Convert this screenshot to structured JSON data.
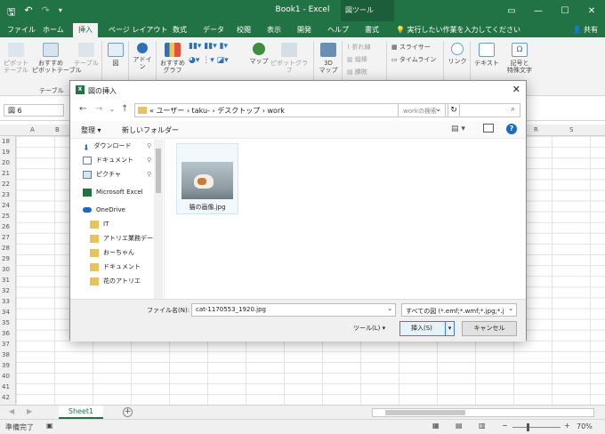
{
  "window": {
    "title": "Book1 - Excel",
    "context_tool": "図ツール"
  },
  "tabs": [
    {
      "label": "ファイル",
      "active": false
    },
    {
      "label": "ホーム",
      "active": false
    },
    {
      "label": "挿入",
      "active": true
    },
    {
      "label": "ページ レイアウト",
      "active": false
    },
    {
      "label": "数式",
      "active": false
    },
    {
      "label": "データ",
      "active": false
    },
    {
      "label": "校閲",
      "active": false
    },
    {
      "label": "表示",
      "active": false
    },
    {
      "label": "開発",
      "active": false
    },
    {
      "label": "ヘルプ",
      "active": false
    },
    {
      "label": "書式",
      "active": false
    }
  ],
  "tellme": "実行したい作業を入力してください",
  "share": "共有",
  "ribbon": {
    "pivot": "ピボット\nテーブル",
    "recommended_pivot": "おすすめ\nピボットテーブル",
    "table": "テーブル",
    "figure": "図",
    "addins": "アドイン",
    "recommended_chart": "おすすめ\nグラフ",
    "map": "マップ",
    "pivot_chart": "ピボットグラフ",
    "map3d": "3D\nマップ",
    "line": "折れ線",
    "column": "縦棒",
    "winloss": "勝敗",
    "slicer": "スライサー",
    "timeline": "タイムライン",
    "link": "リンク",
    "text": "テキスト",
    "symbol": "記号と\n特殊文字",
    "group_table": "テーブル"
  },
  "namebox": "図 6",
  "columns": [
    "A",
    "B",
    "R",
    "S"
  ],
  "rows": [
    "18",
    "19",
    "20",
    "21",
    "22",
    "23",
    "24",
    "25",
    "26",
    "27",
    "28",
    "29",
    "30",
    "31",
    "32",
    "33",
    "34",
    "35",
    "36",
    "37",
    "38",
    "39",
    "40",
    "41",
    "42"
  ],
  "sheet_tab": "Sheet1",
  "status": {
    "ready": "準備完了",
    "zoom": "70%"
  },
  "dialog": {
    "title": "図の挿入",
    "path": "« ユーザー › taku- › デスクトップ › work",
    "search_placeholder": "workの検索",
    "organize": "整理 ▾",
    "new_folder": "新しいフォルダー",
    "nav_items": [
      {
        "label": "ダウンロード",
        "icon": "download-icon",
        "pinned": true
      },
      {
        "label": "ドキュメント",
        "icon": "document-icon",
        "pinned": true
      },
      {
        "label": "ピクチャ",
        "icon": "picture-icon",
        "pinned": true
      },
      {
        "label": "Microsoft Excel",
        "icon": "excel-icon",
        "pinned": false
      },
      {
        "label": "OneDrive",
        "icon": "onedrive-icon",
        "pinned": false
      },
      {
        "label": "IT",
        "icon": "folder-icon",
        "pinned": false
      },
      {
        "label": "アトリエ業務データ",
        "icon": "folder-icon",
        "pinned": false
      },
      {
        "label": "おーちゃん",
        "icon": "folder-icon",
        "pinned": false
      },
      {
        "label": "ドキュメント",
        "icon": "folder-icon",
        "pinned": false
      },
      {
        "label": "花のアトリエ",
        "icon": "folder-icon",
        "pinned": false
      }
    ],
    "file_label": "猫の画像.jpg",
    "filename_label": "ファイル名(N):",
    "filename_value": "cat-1170553_1920.jpg",
    "filter": "すべての図 (*.emf;*.wmf;*.jpg;*.j",
    "tools": "ツール(L)",
    "insert": "挿入(S)",
    "cancel": "キャンセル"
  },
  "colors": {
    "excel_green": "#217346",
    "accent_blue": "#1b6ac9"
  }
}
